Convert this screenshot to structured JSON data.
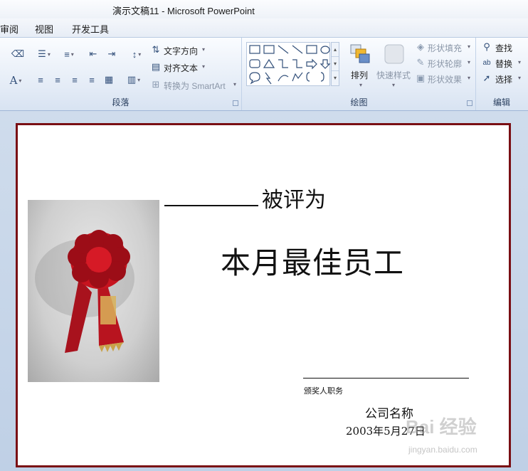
{
  "window": {
    "title": "演示文稿11  -  Microsoft PowerPoint"
  },
  "menu": {
    "tabs": [
      "审阅",
      "视图",
      "开发工具"
    ]
  },
  "ribbon": {
    "paragraph": {
      "label": "段落",
      "text_direction": "文字方向",
      "align_text": "对齐文本",
      "convert_smartart": "转换为 SmartArt"
    },
    "drawing": {
      "label": "绘图",
      "arrange": "排列",
      "quick_styles": "快速样式",
      "shape_fill": "形状填充",
      "shape_outline": "形状轮廓",
      "shape_effects": "形状效果"
    },
    "editing": {
      "label": "编辑",
      "find": "查找",
      "replace": "替换",
      "select": "选择"
    }
  },
  "slide": {
    "awarded_as": "被评为",
    "headline": "本月最佳员工",
    "presenter_title": "颁奖人职务",
    "company": "公司名称",
    "date": "2003年5月27日",
    "border_color": "#7a0f14"
  },
  "watermark": {
    "text": "Bai 经验",
    "url": "jingyan.baidu.com"
  }
}
